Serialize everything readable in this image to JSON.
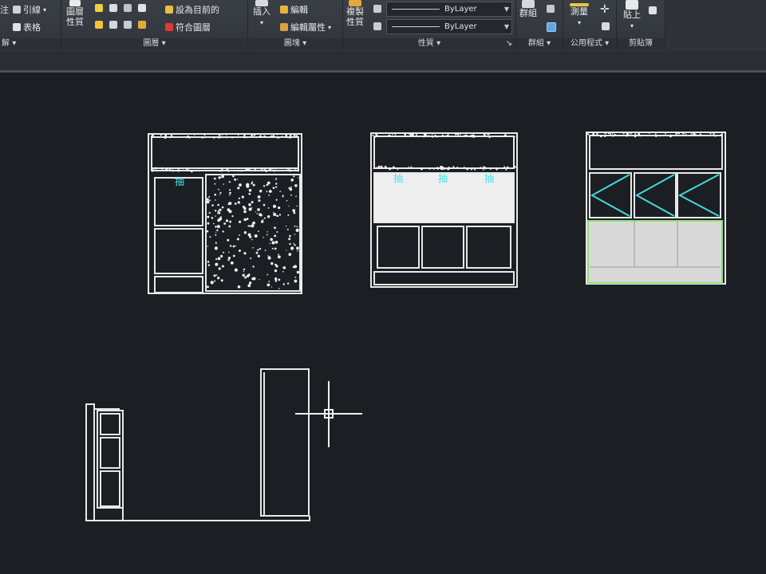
{
  "ribbon": {
    "panel_modify_title": "解",
    "panel_modify_suffix": "▾",
    "annotation_items": {
      "leader": "引線",
      "leader_arrow": "▾",
      "table": "表格",
      "left_cut": "注"
    },
    "layers": {
      "props_line1": "圖層",
      "props_line2": "性質",
      "set_current": "設為目前的",
      "match_layer": "符合圖層",
      "title": "圖層"
    },
    "block": {
      "insert": "插入",
      "edit": "編輯",
      "edit_attr": "編輯屬性",
      "edit_attr_arrow": "▾",
      "title": "圖塊"
    },
    "properties": {
      "match_line1": "複製",
      "match_line2": "性質",
      "bylayer_1": "ByLayer",
      "bylayer_2": "ByLayer",
      "title": "性質",
      "launcher": "↘"
    },
    "groups": {
      "group": "群組",
      "title": "群組"
    },
    "utilities": {
      "measure": "測量",
      "title": "公用程式"
    },
    "clipboard": {
      "paste": "貼上",
      "title": "剪貼簿"
    }
  },
  "drawing": {
    "drawer_label": "抽",
    "colors": {
      "line": "#e8e8e8",
      "cyan": "#43d9dc",
      "cyan_text": "#48e3e6",
      "green": "#8fe07a",
      "hatch": "#f2f2f2",
      "bg": "#1b1e22"
    }
  },
  "icons": {
    "cursor": "crosshair-cursor"
  }
}
